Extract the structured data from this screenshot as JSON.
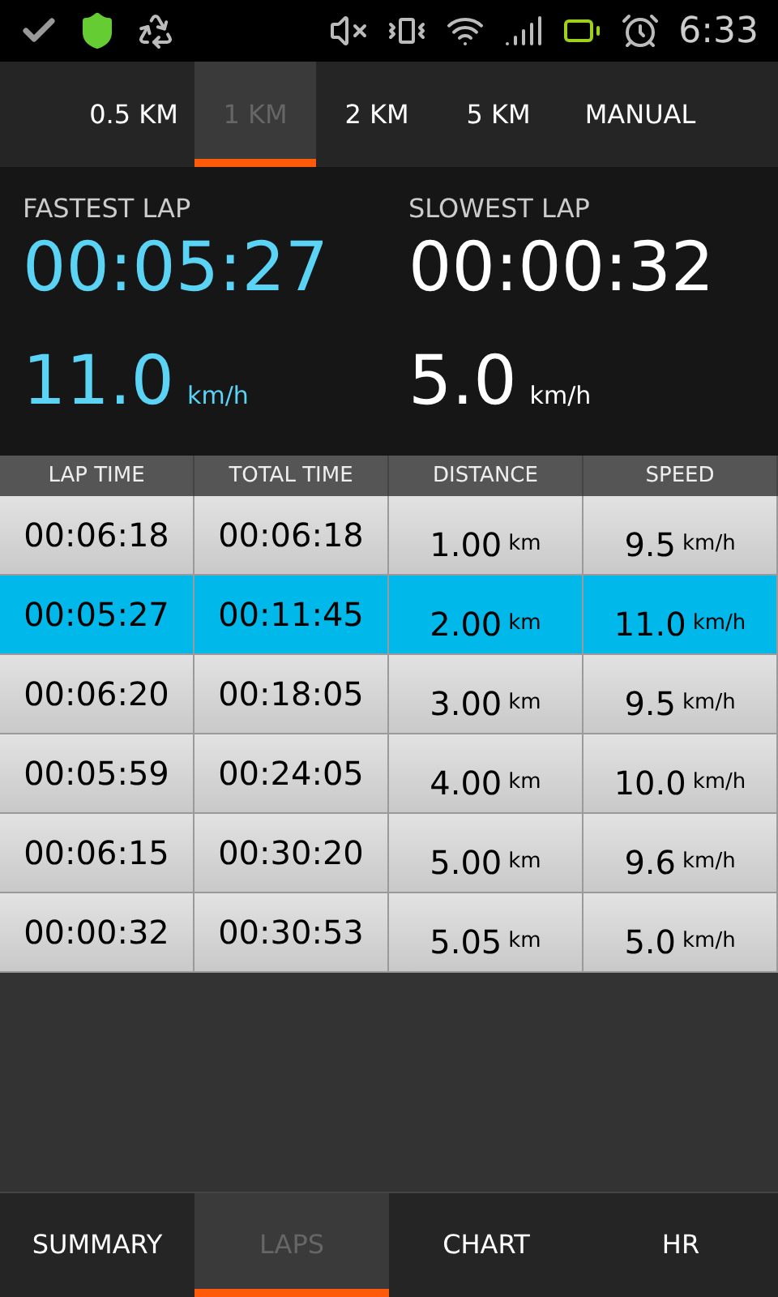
{
  "status_bar": {
    "time": "6:33"
  },
  "interval_tabs": [
    {
      "label": "0.5 KM",
      "selected": false
    },
    {
      "label": "1 KM",
      "selected": true
    },
    {
      "label": "2 KM",
      "selected": false
    },
    {
      "label": "5 KM",
      "selected": false
    },
    {
      "label": "MANUAL",
      "selected": false
    }
  ],
  "stats": [
    {
      "label": "FASTEST LAP",
      "time": "00:05:27",
      "speed": "11.0",
      "unit": "km/h",
      "highlight": true
    },
    {
      "label": "SLOWEST LAP",
      "time": "00:00:32",
      "speed": "5.0",
      "unit": "km/h",
      "highlight": false
    }
  ],
  "table": {
    "columns": [
      "LAP TIME",
      "TOTAL TIME",
      "DISTANCE",
      "SPEED"
    ],
    "rows": [
      {
        "lap_time": "00:06:18",
        "total_time": "00:06:18",
        "distance": "1.00",
        "distance_unit": "km",
        "speed": "9.5",
        "speed_unit": "km/h",
        "selected": false
      },
      {
        "lap_time": "00:05:27",
        "total_time": "00:11:45",
        "distance": "2.00",
        "distance_unit": "km",
        "speed": "11.0",
        "speed_unit": "km/h",
        "selected": true
      },
      {
        "lap_time": "00:06:20",
        "total_time": "00:18:05",
        "distance": "3.00",
        "distance_unit": "km",
        "speed": "9.5",
        "speed_unit": "km/h",
        "selected": false
      },
      {
        "lap_time": "00:05:59",
        "total_time": "00:24:05",
        "distance": "4.00",
        "distance_unit": "km",
        "speed": "10.0",
        "speed_unit": "km/h",
        "selected": false
      },
      {
        "lap_time": "00:06:15",
        "total_time": "00:30:20",
        "distance": "5.00",
        "distance_unit": "km",
        "speed": "9.6",
        "speed_unit": "km/h",
        "selected": false
      },
      {
        "lap_time": "00:00:32",
        "total_time": "00:30:53",
        "distance": "5.05",
        "distance_unit": "km",
        "speed": "5.0",
        "speed_unit": "km/h",
        "selected": false
      }
    ]
  },
  "bottom_tabs": [
    {
      "label": "SUMMARY",
      "selected": false
    },
    {
      "label": "LAPS",
      "selected": true
    },
    {
      "label": "CHART",
      "selected": false
    },
    {
      "label": "HR",
      "selected": false
    }
  ]
}
